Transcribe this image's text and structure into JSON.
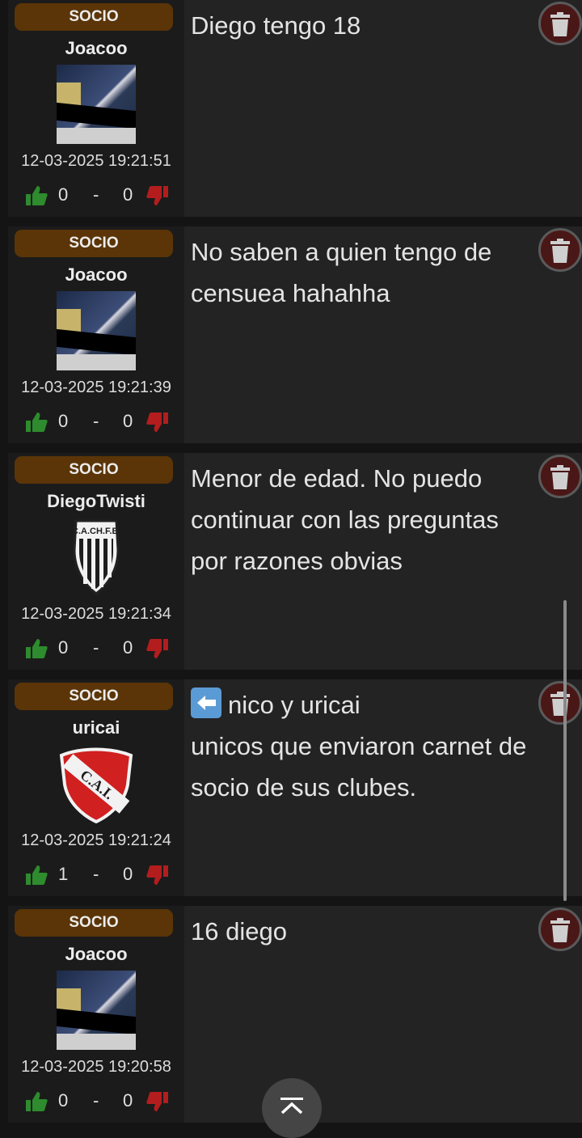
{
  "posts": [
    {
      "badge": "SOCIO",
      "user": "Joacoo",
      "avatar": "photo-avatar",
      "date": "12-03-2025 19:21:51",
      "likes": "0",
      "separator": "-",
      "dislikes": "0",
      "lines": [
        "Diego tengo 18"
      ]
    },
    {
      "badge": "SOCIO",
      "user": "Joacoo",
      "avatar": "photo-avatar",
      "date": "12-03-2025 19:21:39",
      "likes": "0",
      "separator": "-",
      "dislikes": "0",
      "lines": [
        "No saben a quien tengo de",
        "censuea hahahha"
      ]
    },
    {
      "badge": "SOCIO",
      "user": "DiegoTwisti",
      "avatar": "club-crest-cachfe",
      "crest_text": "C.A.CH.F.E.",
      "date": "12-03-2025 19:21:34",
      "likes": "0",
      "separator": "-",
      "dislikes": "0",
      "lines": [
        "Menor de edad. No puedo",
        "continuar con las preguntas",
        "por razones obvias"
      ]
    },
    {
      "badge": "SOCIO",
      "user": "uricai",
      "avatar": "club-crest-cai",
      "crest_text": "C.A.I.",
      "date": "12-03-2025 19:21:24",
      "likes": "1",
      "separator": "-",
      "dislikes": "0",
      "lines": [
        "nico y uricai",
        "unicos que enviaron carnet de",
        "socio de sus clubes."
      ],
      "leading_icon": "left-arrow-emoji"
    },
    {
      "badge": "SOCIO",
      "user": "Joacoo",
      "avatar": "photo-avatar",
      "date": "12-03-2025 19:20:58",
      "likes": "0",
      "separator": "-",
      "dislikes": "0",
      "lines": [
        "16 diego"
      ]
    }
  ],
  "icons": {
    "like": "thumbs-up-icon",
    "dislike": "thumbs-down-icon",
    "delete": "trash-icon",
    "scroll_top": "chevron-up-icon"
  },
  "colors": {
    "badge": "#5b3507",
    "like": "#2e8b2e",
    "dislike": "#b31d1d",
    "delete_bg": "#4a1717"
  }
}
